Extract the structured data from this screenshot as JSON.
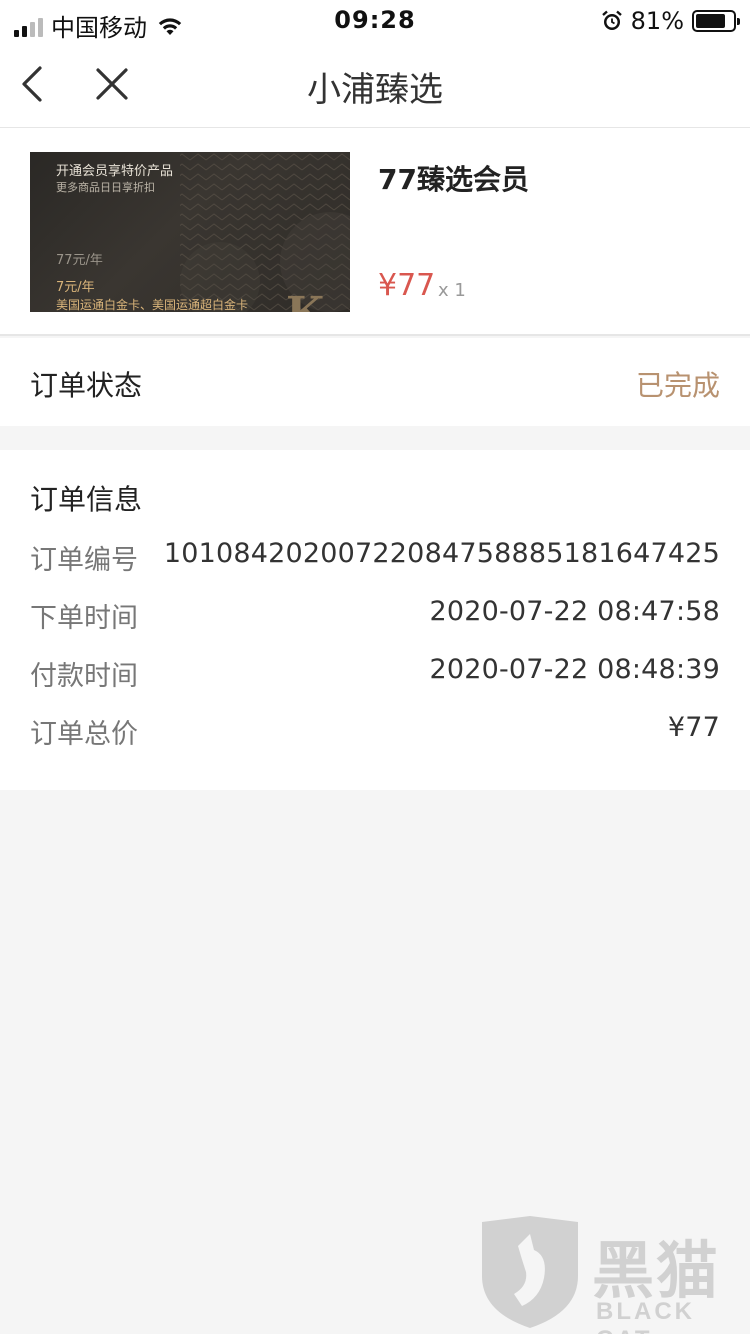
{
  "status_bar": {
    "carrier": "中国移动",
    "time": "09:28",
    "battery_percent": "81%",
    "battery_level": 0.81
  },
  "nav": {
    "title": "小浦臻选",
    "back_icon": "chevron-left-icon",
    "close_icon": "close-icon"
  },
  "product": {
    "name": "77臻选会员",
    "price": "¥77",
    "quantity": "x 1",
    "image": {
      "line1": "开通会员享特价产品",
      "line2": "更多商品日日享折扣",
      "line3": "77元/年",
      "line4": "7元/年",
      "line5": "美国运通白金卡、美国运通超白金卡",
      "logo": "K"
    }
  },
  "order_status": {
    "label": "订单状态",
    "value": "已完成",
    "value_color": "#b89270"
  },
  "order_info": {
    "title": "订单信息",
    "rows": [
      {
        "key": "订单编号",
        "value": "1010842020072208475888518164742​5"
      },
      {
        "key": "下单时间",
        "value": "2020-07-22 08:47:58"
      },
      {
        "key": "付款时间",
        "value": "2020-07-22 08:48:39"
      },
      {
        "key": "订单总价",
        "value": "¥77"
      }
    ]
  },
  "watermark": {
    "cn": "黑猫",
    "en": "BLACK CAT"
  },
  "colors": {
    "price": "#d9574f",
    "accent": "#b89270",
    "background": "#f5f5f5"
  }
}
